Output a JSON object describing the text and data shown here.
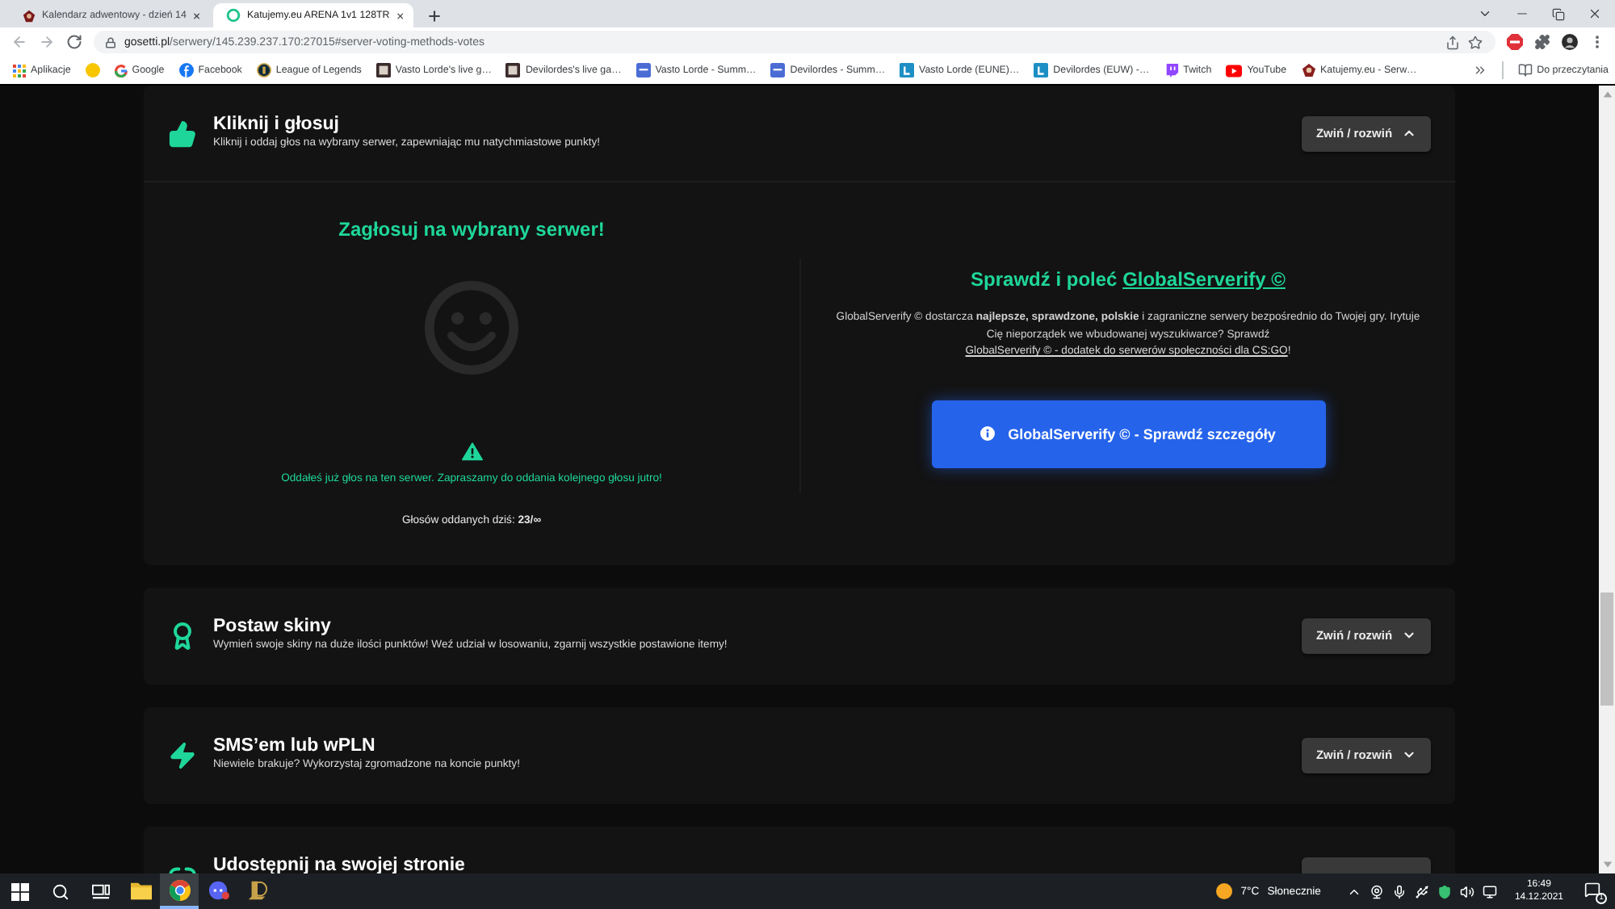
{
  "browser": {
    "tabs": [
      {
        "title": "Kalendarz adwentowy - dzień 14",
        "kind": "site",
        "selected": false
      },
      {
        "title": "Katujemy.eu ARENA 1v1 128TR",
        "kind": "ring",
        "selected": true
      }
    ],
    "address": {
      "host": "gosetti.pl",
      "path": "/serwery/145.239.237.170:27015#server-voting-methods-votes"
    },
    "bookmarks": [
      {
        "kind": "apps",
        "label": "Aplikacje"
      },
      {
        "kind": "dot"
      },
      {
        "kind": "google",
        "label": "Google"
      },
      {
        "kind": "facebook",
        "label": "Facebook"
      },
      {
        "kind": "emblem",
        "label": "League of Legends"
      },
      {
        "kind": "picture",
        "label": "Vasto Lorde's live g…"
      },
      {
        "kind": "picture",
        "label": "Devilordes's live ga…"
      },
      {
        "kind": "doc",
        "label": "Vasto Lorde - Summ…"
      },
      {
        "kind": "doc",
        "label": "Devilordes - Summ…"
      },
      {
        "kind": "tile",
        "label": "Vasto Lorde (EUNE)…"
      },
      {
        "kind": "tile",
        "label": "Devilordes (EUW) -…"
      },
      {
        "kind": "bubble",
        "label": "Twitch"
      },
      {
        "kind": "play",
        "label": "YouTube"
      },
      {
        "kind": "logo",
        "label": "Katujemy.eu - Serw…"
      }
    ],
    "reading_list": "Do przeczytania"
  },
  "sections": [
    {
      "kind": "thumb",
      "title": "Kliknij i głosuj",
      "subtitle": "Kliknij i oddaj głos na wybrany serwer, zapewniając mu natychmiastowe punkty!",
      "toggle": "Zwiń / rozwiń",
      "expanded": true,
      "vote": {
        "heading": "Zagłosuj na wybrany serwer!",
        "notice": "Oddałeś już głos na ten serwer. Zapraszamy do oddania kolejnego głosu jutro!",
        "count": "Głosów oddanych dziś: **23/∞**"
      },
      "promo": {
        "heading": "Sprawdź i poleć",
        "heading_link": "GlobalServerify ©",
        "text": "GlobalServerify © dostarcza **najlepsze, sprawdzone, polskie** i zagraniczne serwery bezpośrednio do Twojej gry. Irytuje Cię nieporządek we wbudowanej wyszukiwarce? Sprawdź",
        "link": "GlobalServerify © - dodatek do serwerów społeczności dla CS:GO",
        "text_end": "!",
        "button": "GlobalServerify © - Sprawdź szczegóły"
      }
    },
    {
      "kind": "award",
      "title": "Postaw skiny",
      "subtitle": "Wymień swoje skiny na duże ilości punktów! Weź udział w losowaniu, zgarnij wszystkie postawione itemy!",
      "toggle": "Zwiń / rozwiń",
      "expanded": false
    },
    {
      "kind": "bolt",
      "title": "SMS’em lub wPLN",
      "subtitle": "Niewiele brakuje? Wykorzystaj zgromadzone na koncie punkty!",
      "toggle": "Zwiń / rozwiń",
      "expanded": false
    },
    {
      "kind": "link",
      "title": "Udostępnij na swojej stronie"
    }
  ],
  "taskbar": {
    "apps": [
      {
        "kind": "folder",
        "selected": false
      },
      {
        "kind": "browser",
        "selected": true
      },
      {
        "kind": "chat",
        "selected": false
      },
      {
        "kind": "emblem",
        "selected": false
      }
    ],
    "weather": {
      "temperature": "7°C",
      "condition": "Słonecznie"
    },
    "clock": {
      "time": "16:49",
      "date": "14.12.2021"
    },
    "notifications": "1"
  }
}
